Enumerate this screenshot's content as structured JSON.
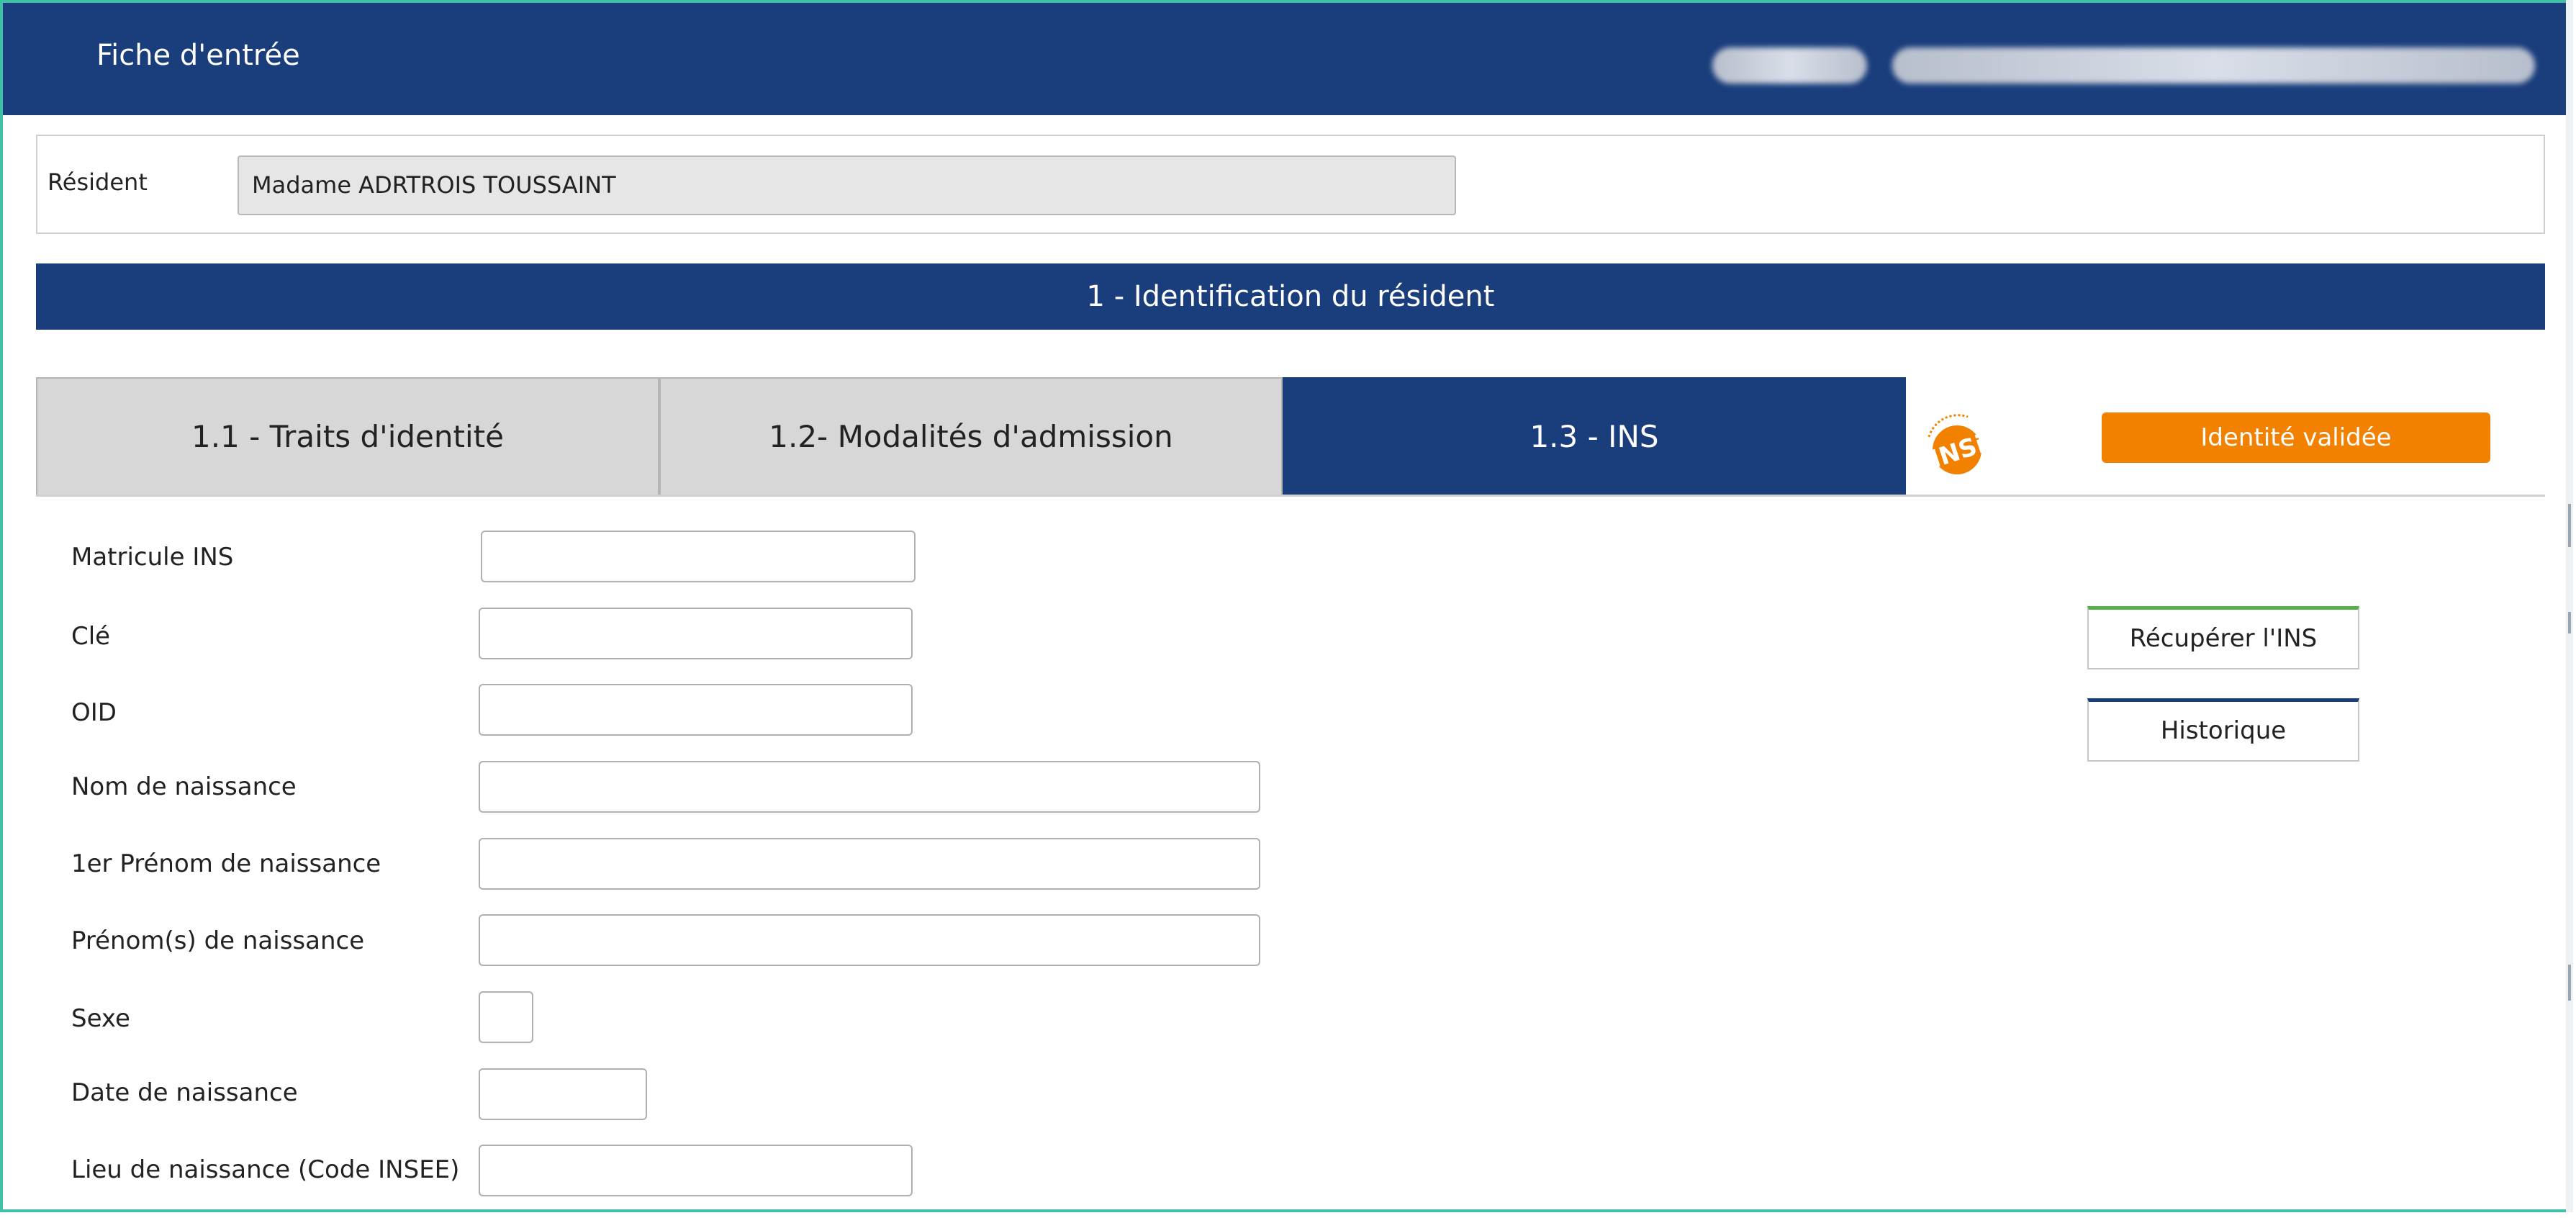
{
  "window": {
    "title": "Fiche d'entrée"
  },
  "resident": {
    "label": "Résident",
    "value": "Madame ADRTROIS TOUSSAINT"
  },
  "section": {
    "title": "1 - Identification du résident"
  },
  "tabs": [
    {
      "label": "1.1 - Traits d'identité",
      "active": false
    },
    {
      "label": "1.2- Modalités d'admission",
      "active": false
    },
    {
      "label": "1.3 - INS",
      "active": true
    }
  ],
  "status_badge": "Identité validée",
  "actions": {
    "recuperer_label": "Récupérer l'INS",
    "historique_label": "Historique"
  },
  "fields": [
    {
      "label": "Matricule INS",
      "value": ""
    },
    {
      "label": "Clé",
      "value": ""
    },
    {
      "label": "OID",
      "value": ""
    },
    {
      "label": "Nom de naissance",
      "value": ""
    },
    {
      "label": "1er Prénom de naissance",
      "value": ""
    },
    {
      "label": "Prénom(s) de naissance",
      "value": ""
    },
    {
      "label": "Sexe",
      "value": ""
    },
    {
      "label": "Date de naissance",
      "value": ""
    },
    {
      "label": "Lieu de naissance (Code INSEE)",
      "value": ""
    }
  ],
  "colors": {
    "header_blue": "#1a3d7c",
    "badge_orange": "#f28100",
    "frame_teal": "#3fbfa6",
    "btn_green_accent": "#55b04a"
  },
  "icons": {
    "ins_logo": "ins-logo-icon"
  }
}
